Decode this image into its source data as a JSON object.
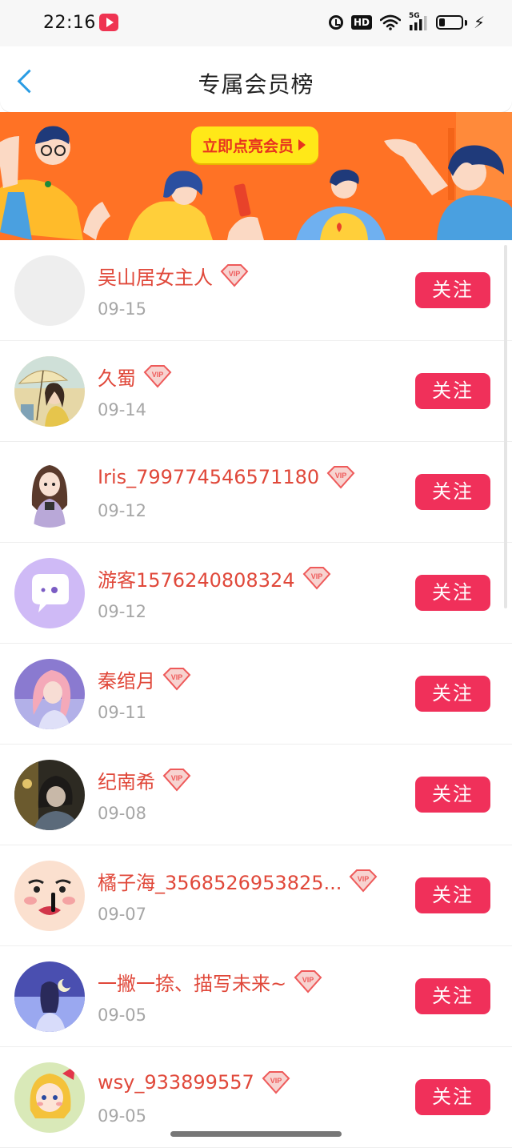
{
  "status_bar": {
    "time": "22:16",
    "app_icon": "video-app-icon",
    "icons": [
      "alarm-icon",
      "hd-icon",
      "wifi-icon",
      "5g-signal-icon",
      "battery-icon",
      "charging-bolt-icon"
    ],
    "hd_label": "HD",
    "network_label": "5G"
  },
  "header": {
    "back_icon": "chevron-left-icon",
    "title": "专属会员榜"
  },
  "banner": {
    "cta_label": "立即点亮会员",
    "cta_icon": "triangle-right-icon",
    "background_color": "#ff7225",
    "cta_color": "#ffe818"
  },
  "members": [
    {
      "name": "吴山居女主人",
      "date": "09-15",
      "follow_label": "关注",
      "avatar": "blank-avatar"
    },
    {
      "name": "久蜀",
      "date": "09-14",
      "follow_label": "关注",
      "avatar": "girl-with-umbrella-avatar"
    },
    {
      "name": "Iris_799774546571180",
      "date": "09-12",
      "follow_label": "关注",
      "avatar": "cartoon-girl-avatar"
    },
    {
      "name": "游客1576240808324",
      "date": "09-12",
      "follow_label": "关注",
      "avatar": "chat-bubble-avatar"
    },
    {
      "name": "秦绾月",
      "date": "09-11",
      "follow_label": "关注",
      "avatar": "pink-hair-girl-avatar"
    },
    {
      "name": "纪南希",
      "date": "09-08",
      "follow_label": "关注",
      "avatar": "dark-portrait-avatar"
    },
    {
      "name": "橘子海_3568526953825...",
      "date": "09-07",
      "follow_label": "关注",
      "avatar": "funny-face-avatar"
    },
    {
      "name": "一撇一捺、描写未来~",
      "date": "09-05",
      "follow_label": "关注",
      "avatar": "moon-night-avatar"
    },
    {
      "name": "wsy_933899557",
      "date": "09-05",
      "follow_label": "关注",
      "avatar": "anime-girl-avatar"
    }
  ],
  "vip_badge": {
    "label": "VIP",
    "icon": "vip-diamond-icon"
  },
  "colors": {
    "accent": "#f0305a",
    "name_color": "#e0483a",
    "date_color": "#a6a6a6",
    "back_color": "#2a9ce4"
  }
}
